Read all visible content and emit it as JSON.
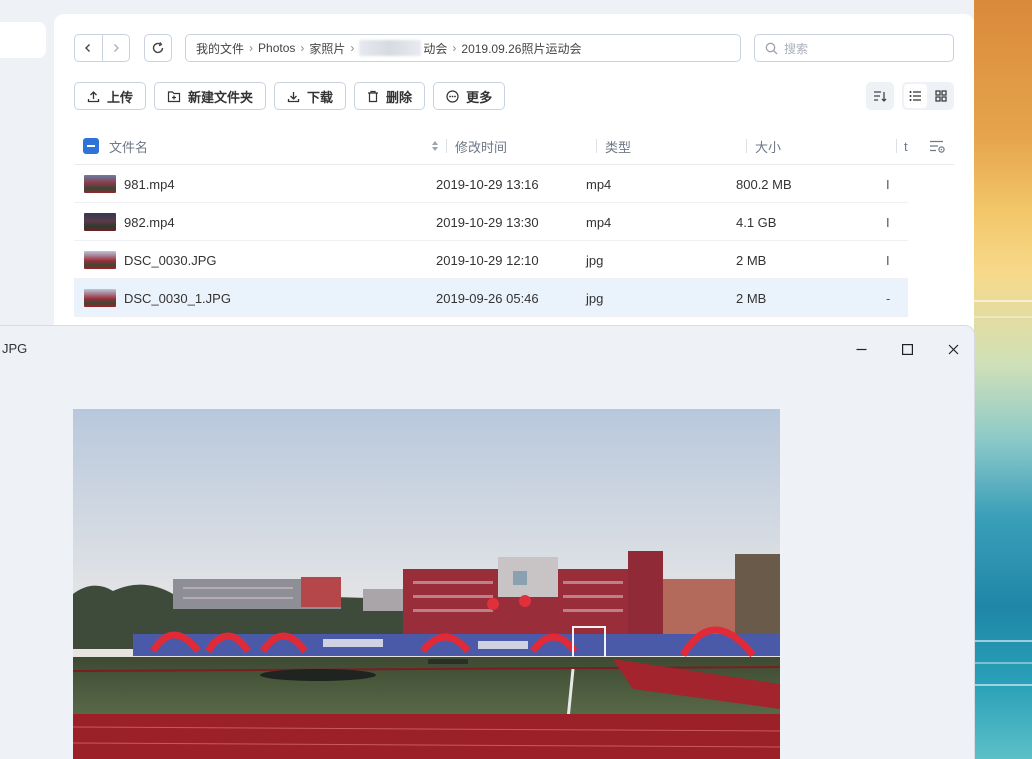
{
  "navigation": {
    "back_icon": "chevron-left-icon",
    "forward_icon": "chevron-right-icon",
    "refresh_icon": "refresh-icon"
  },
  "breadcrumb": {
    "items": [
      "我的文件",
      "Photos",
      "家照片"
    ],
    "partial_item": "动会",
    "current": "2019.09.26照片运动会"
  },
  "search": {
    "placeholder": "搜索",
    "icon": "search-icon"
  },
  "toolbar": {
    "upload_label": "上传",
    "new_folder_label": "新建文件夹",
    "download_label": "下载",
    "delete_label": "删除",
    "more_label": "更多"
  },
  "table": {
    "columns": {
      "name": "文件名",
      "modified": "修改时间",
      "type": "类型",
      "size": "大小",
      "extra": "t"
    },
    "rows": [
      {
        "name": "981.mp4",
        "modified": "2019-10-29 13:16",
        "type": "mp4",
        "size": "800.2 MB",
        "extra": "I",
        "selected": false
      },
      {
        "name": "982.mp4",
        "modified": "2019-10-29 13:30",
        "type": "mp4",
        "size": "4.1 GB",
        "extra": "I",
        "selected": false
      },
      {
        "name": "DSC_0030.JPG",
        "modified": "2019-10-29 12:10",
        "type": "jpg",
        "size": "2 MB",
        "extra": "I",
        "selected": false
      },
      {
        "name": "DSC_0030_1.JPG",
        "modified": "2019-09-26 05:46",
        "type": "jpg",
        "size": "2 MB",
        "extra": "-",
        "selected": true
      }
    ]
  },
  "viewer": {
    "title": "JPG",
    "minimize_icon": "minimize-icon",
    "maximize_icon": "maximize-icon",
    "close_icon": "close-icon"
  },
  "colors": {
    "accent": "#2f73da",
    "selected_row": "#eaf2fc",
    "border": "#c9d2de"
  }
}
